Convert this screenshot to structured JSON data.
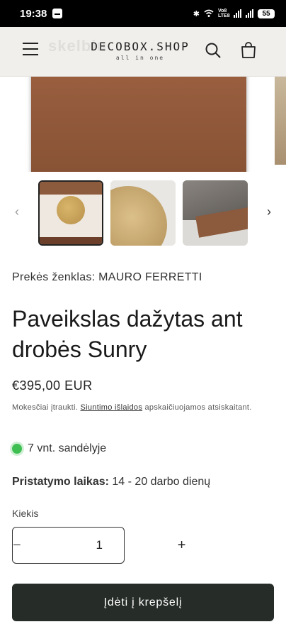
{
  "status_bar": {
    "time": "19:38",
    "network_label": "Vo8 LTE8",
    "battery": "55"
  },
  "header": {
    "logo_main": "DECOBOX.SHOP",
    "logo_tagline": "all in one",
    "watermark": "skelbiu"
  },
  "product": {
    "brand": "Prekės ženklas: MAURO FERRETTI",
    "title": "Paveikslas dažytas ant drobės Sunry",
    "price": "€395,00 EUR",
    "tax_note_prefix": "Mokesčiai įtraukti. ",
    "tax_note_link": "Siuntimo išlaidos",
    "tax_note_suffix": " apskaičiuojamos atsiskaitant.",
    "stock": "7 vnt. sandėlyje",
    "delivery_label": "Pristatymo laikas:",
    "delivery_value": " 14 - 20 darbo dienų"
  },
  "quantity": {
    "label": "Kiekis",
    "value": "1",
    "minus": "−",
    "plus": "+"
  },
  "add_to_cart_label": "Įdėti į krepšelį",
  "colors": {
    "header_bg": "#f1efec",
    "button_bg": "#262c28",
    "stock_dot": "#3fbf52"
  }
}
